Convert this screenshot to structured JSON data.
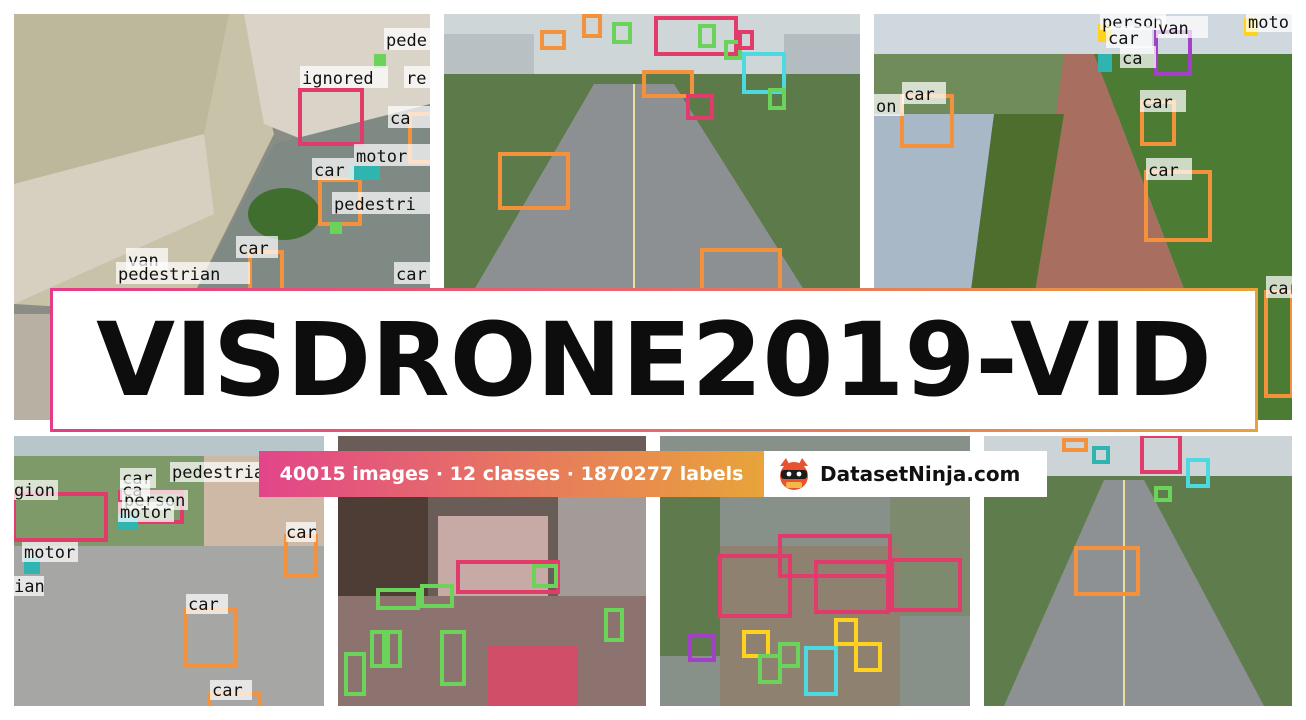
{
  "title": "VISDRONE2019-VID",
  "stats": "40015 images · 12 classes · 1870277 labels",
  "brand": {
    "name": "DatasetNinja.com",
    "logo_icon": "ninja-cat-icon"
  },
  "colors": {
    "car": "#f3913c",
    "pedestrian": "#e03b6a",
    "person": "#6bd35a",
    "van": "#a240c8",
    "motor": "#2fb4b0",
    "ignored": "#e0315f",
    "bus": "#ffd21f",
    "truck": "#4dd9e0"
  },
  "tiles": [
    {
      "labels": [
        "pede",
        "ignored",
        "re",
        "ca",
        "motor",
        "car",
        "pedestri",
        "van",
        "pedestrian",
        "car",
        "car"
      ]
    },
    {
      "labels": []
    },
    {
      "labels": [
        "person",
        "van",
        "car",
        "ca",
        "car",
        "car",
        "on",
        "car",
        "moto",
        "car"
      ]
    },
    {
      "labels": [
        "gion",
        "car",
        "pedestrian",
        "ca",
        "person",
        "motor",
        "motor",
        "ian",
        "car",
        "car",
        "car"
      ]
    },
    {
      "labels": []
    },
    {
      "labels": []
    },
    {
      "labels": []
    }
  ]
}
